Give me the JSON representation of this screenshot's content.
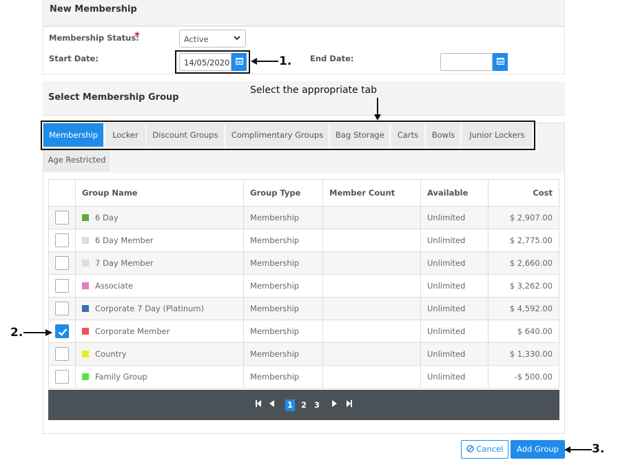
{
  "header": {
    "title": "New Membership"
  },
  "form": {
    "status_label": "Membership Status:",
    "required_mark": "*",
    "status_value": "Active",
    "start_date_label": "Start Date:",
    "start_date_value": "14/05/2020",
    "end_date_label": "End Date:",
    "end_date_value": ""
  },
  "group": {
    "title": "Select Membership Group"
  },
  "tabs": [
    {
      "label": "Membership",
      "active": true
    },
    {
      "label": "Locker"
    },
    {
      "label": "Discount Groups"
    },
    {
      "label": "Complimentary Groups"
    },
    {
      "label": "Bag Storage"
    },
    {
      "label": "Carts"
    },
    {
      "label": "Bowls"
    },
    {
      "label": "Junior Lockers"
    },
    {
      "label": "Age Restricted"
    }
  ],
  "table": {
    "columns": [
      "Group Name",
      "Group Type",
      "Member Count",
      "Available",
      "Cost"
    ],
    "rows": [
      {
        "name": "6 Day",
        "type": "Membership",
        "count": "",
        "available": "Unlimited",
        "cost": "$ 2,907.00",
        "color": "#5cab3c",
        "checked": false
      },
      {
        "name": "6 Day Member",
        "type": "Membership",
        "count": "",
        "available": "Unlimited",
        "cost": "$ 2,775.00",
        "color": "#dddddd",
        "checked": false
      },
      {
        "name": "7 Day Member",
        "type": "Membership",
        "count": "",
        "available": "Unlimited",
        "cost": "$ 2,660.00",
        "color": "#dddddd",
        "checked": false
      },
      {
        "name": "Associate",
        "type": "Membership",
        "count": "",
        "available": "Unlimited",
        "cost": "$ 3,262.00",
        "color": "#e07fc2",
        "checked": false
      },
      {
        "name": "Corporate 7 Day (Platinum)",
        "type": "Membership",
        "count": "",
        "available": "Unlimited",
        "cost": "$ 4,592.00",
        "color": "#3d6fb2",
        "checked": false
      },
      {
        "name": "Corporate Member",
        "type": "Membership",
        "count": "",
        "available": "Unlimited",
        "cost": "$ 640.00",
        "color": "#f0505a",
        "checked": true
      },
      {
        "name": "Country",
        "type": "Membership",
        "count": "",
        "available": "Unlimited",
        "cost": "$ 1,330.00",
        "color": "#e4f025",
        "checked": false
      },
      {
        "name": "Family Group",
        "type": "Membership",
        "count": "",
        "available": "Unlimited",
        "cost": "-$ 500.00",
        "color": "#5fe04a",
        "checked": false
      }
    ]
  },
  "pagination": {
    "pages": [
      "1",
      "2",
      "3"
    ],
    "current": "1"
  },
  "buttons": {
    "cancel": "Cancel",
    "add": "Add Group"
  },
  "annotations": {
    "step1": "1.",
    "step2": "2.",
    "step3": "3.",
    "tab_hint": "Select the appropriate tab"
  },
  "colors": {
    "accent": "#1f8bea",
    "pager_bg": "#4a5258"
  }
}
